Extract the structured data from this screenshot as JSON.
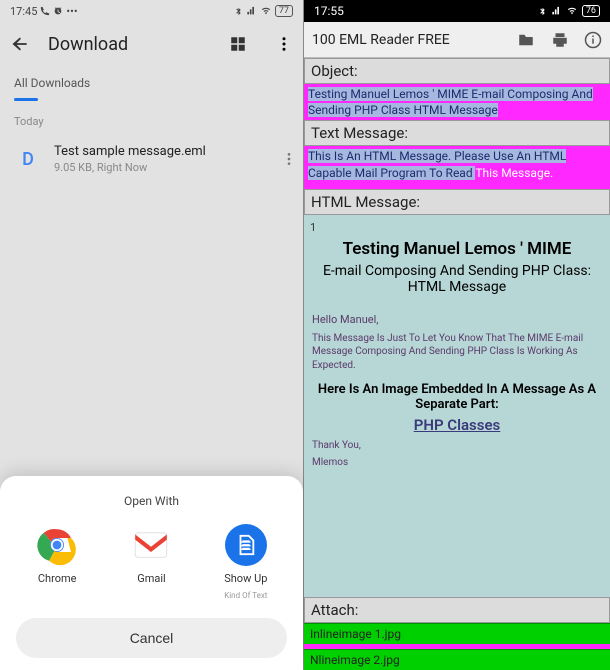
{
  "left": {
    "status": {
      "time": "17:45",
      "battery": "77"
    },
    "header": {
      "title": "Download"
    },
    "tab_label": "All Downloads",
    "section_today": "Today",
    "file": {
      "thumb_letter": "D",
      "name": "Test sample message.eml",
      "size": "9.05 KB",
      "when": "Right Now"
    },
    "sheet": {
      "title": "Open With",
      "apps": [
        {
          "label": "Chrome",
          "sub": ""
        },
        {
          "label": "Gmail",
          "sub": ""
        },
        {
          "label": "Show Up",
          "sub": "Kind Of Text"
        }
      ],
      "cancel": "Cancel"
    }
  },
  "right": {
    "status": {
      "time": "17:55",
      "battery": "76"
    },
    "toolbar": {
      "title": "100 EML Reader FREE"
    },
    "labels": {
      "object": "Object:",
      "text": "Text Message:",
      "html": "HTML Message:",
      "attach": "Attach:"
    },
    "object_value": "Testing Manuel Lemos ' MIME E-mail Composing And Sending PHP Class HTML Message",
    "text_value_sel": "This Is An HTML Message. Please Use An HTML Capable Mail Program To Read ",
    "text_value_rest": "This Message.",
    "html_msg": {
      "num": "1",
      "title": "Testing Manuel Lemos ' MIME",
      "sub": "E-mail Composing And Sending PHP Class: HTML Message",
      "hello": "Hello Manuel,",
      "body": "This Message Is Just To Let You Know That The MIME E-mail Message Composing And Sending PHP Class Is Working As Expected.",
      "embed_title": "Here Is An Image Embedded In A Message As A Separate Part:",
      "link": "PHP Classes",
      "thank1": "Thank You,",
      "thank2": "Mlemos"
    },
    "attachments": [
      "Inlineimage 1.jpg",
      "Nlineimage 2.jpg"
    ]
  }
}
